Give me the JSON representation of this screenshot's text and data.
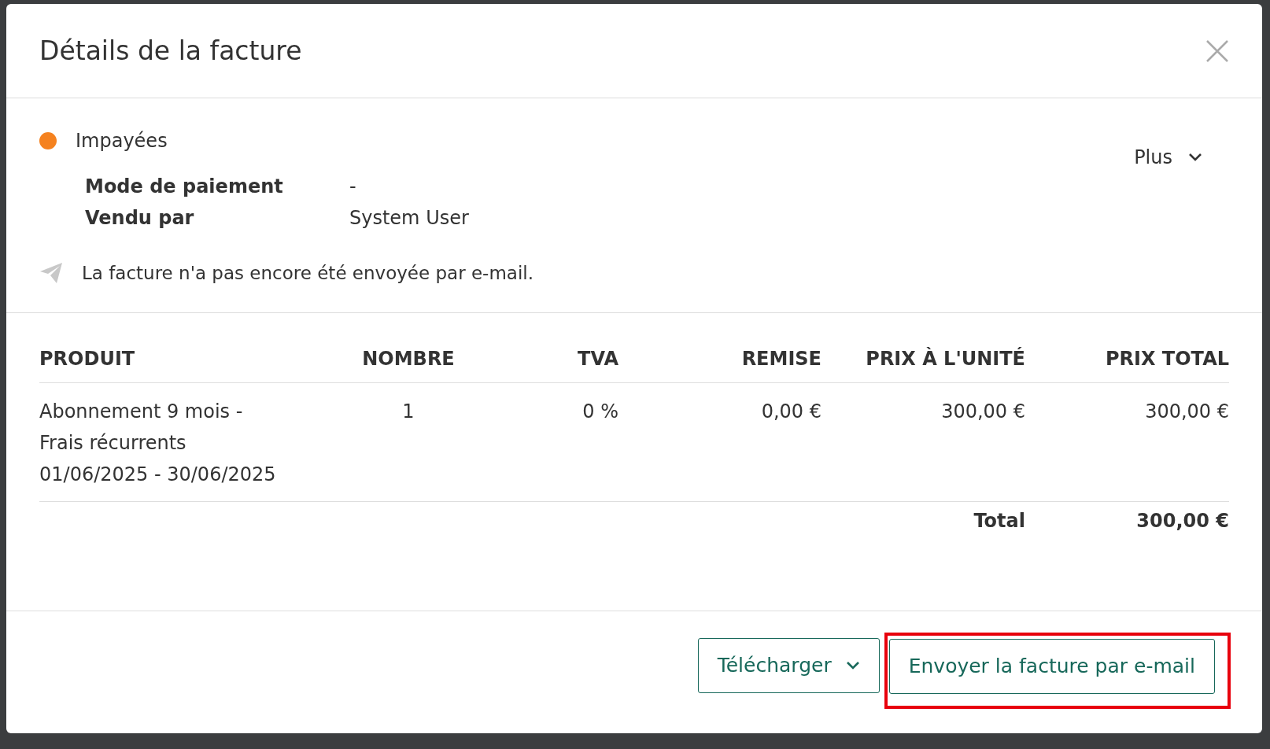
{
  "dialog": {
    "title": "Détails de la facture"
  },
  "status": {
    "label": "Impayées",
    "color": "#f5821f"
  },
  "more_menu": {
    "label": "Plus"
  },
  "details": [
    {
      "label": "Mode de paiement",
      "value": "-"
    },
    {
      "label": "Vendu par",
      "value": "System User"
    }
  ],
  "email_note": "La facture n'a pas encore été envoyée par e-mail.",
  "table": {
    "columns": [
      "PRODUIT",
      "NOMBRE",
      "TVA",
      "REMISE",
      "PRIX À L'UNITÉ",
      "PRIX TOTAL"
    ],
    "rows": [
      {
        "product": [
          "Abonnement 9 mois -",
          "Frais récurrents",
          "01/06/2025 - 30/06/2025"
        ],
        "quantity": "1",
        "vat": "0 %",
        "discount": "0,00 €",
        "unit_price": "300,00 €",
        "total_price": "300,00 €"
      }
    ],
    "total_label": "Total",
    "total_value": "300,00 €"
  },
  "buttons": [
    {
      "label": "Télécharger",
      "kind": "dropdown",
      "highlighted": false
    },
    {
      "label": "Envoyer la facture par e-mail",
      "kind": "plain",
      "highlighted": true
    }
  ]
}
